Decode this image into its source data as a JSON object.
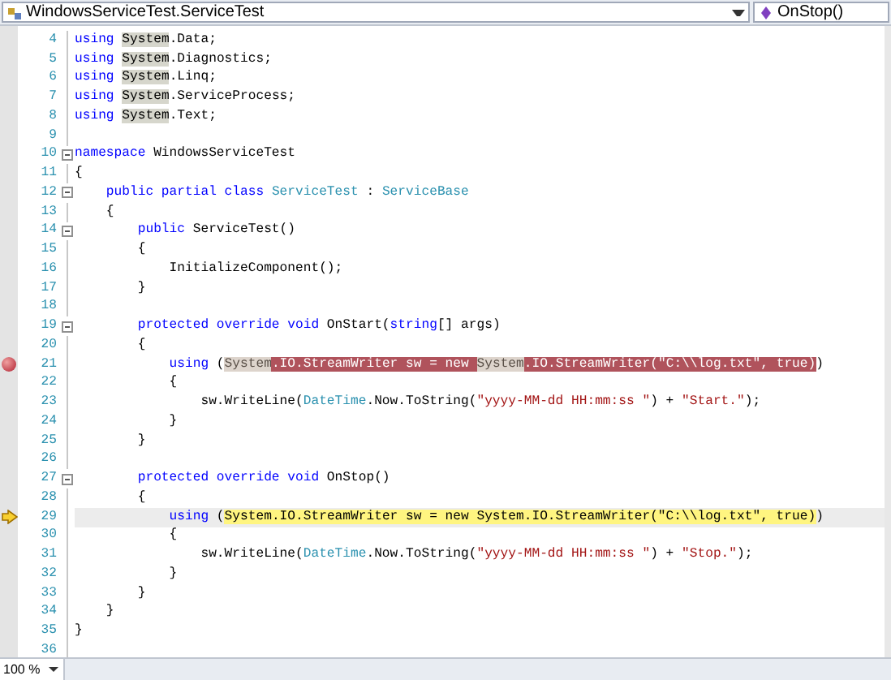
{
  "navigation_bar": {
    "type_dropdown": "WindowsServiceTest.ServiceTest",
    "member_dropdown": "OnStop()"
  },
  "editor": {
    "lines": [
      {
        "number": "4",
        "breakpoint": false,
        "current": false,
        "collapsible": false,
        "segments": [
          {
            "text": "using ",
            "kind": "keyword"
          },
          {
            "text": "System",
            "kind": "reference"
          },
          {
            "text": ".Data;",
            "kind": "plain"
          }
        ]
      },
      {
        "number": "5",
        "breakpoint": false,
        "current": false,
        "collapsible": false,
        "segments": [
          {
            "text": "using ",
            "kind": "keyword"
          },
          {
            "text": "System",
            "kind": "reference"
          },
          {
            "text": ".Diagnostics;",
            "kind": "plain"
          }
        ]
      },
      {
        "number": "6",
        "breakpoint": false,
        "current": false,
        "collapsible": false,
        "segments": [
          {
            "text": "using ",
            "kind": "keyword"
          },
          {
            "text": "System",
            "kind": "reference"
          },
          {
            "text": ".Linq;",
            "kind": "plain"
          }
        ]
      },
      {
        "number": "7",
        "breakpoint": false,
        "current": false,
        "collapsible": false,
        "segments": [
          {
            "text": "using ",
            "kind": "keyword"
          },
          {
            "text": "System",
            "kind": "reference"
          },
          {
            "text": ".ServiceProcess;",
            "kind": "plain"
          }
        ]
      },
      {
        "number": "8",
        "breakpoint": false,
        "current": false,
        "collapsible": false,
        "segments": [
          {
            "text": "using ",
            "kind": "keyword"
          },
          {
            "text": "System",
            "kind": "reference"
          },
          {
            "text": ".Text;",
            "kind": "plain"
          }
        ]
      },
      {
        "number": "9",
        "breakpoint": false,
        "current": false,
        "collapsible": false
      },
      {
        "number": "10",
        "breakpoint": false,
        "current": false,
        "collapsible": true,
        "segments": [
          {
            "text": "namespace",
            "kind": "keyword"
          },
          {
            "text": " WindowsServiceTest",
            "kind": "plain"
          }
        ]
      },
      {
        "number": "11",
        "breakpoint": false,
        "current": false,
        "collapsible": false,
        "segments": [
          {
            "text": "{",
            "kind": "plain"
          }
        ]
      },
      {
        "number": "12",
        "breakpoint": false,
        "current": false,
        "collapsible": true,
        "segments": [
          {
            "text": "    public partial class ",
            "kind": "keyword"
          },
          {
            "text": "ServiceTest",
            "kind": "type"
          },
          {
            "text": " : ",
            "kind": "plain"
          },
          {
            "text": "ServiceBase",
            "kind": "type"
          }
        ]
      },
      {
        "number": "13",
        "breakpoint": false,
        "current": false,
        "collapsible": false,
        "segments": [
          {
            "text": "    {",
            "kind": "plain"
          }
        ]
      },
      {
        "number": "14",
        "breakpoint": false,
        "current": false,
        "collapsible": true,
        "segments": [
          {
            "text": "        public",
            "kind": "keyword"
          },
          {
            "text": " ServiceTest()",
            "kind": "plain"
          }
        ]
      },
      {
        "number": "15",
        "breakpoint": false,
        "current": false,
        "collapsible": false,
        "segments": [
          {
            "text": "        {",
            "kind": "plain"
          }
        ]
      },
      {
        "number": "16",
        "breakpoint": false,
        "current": false,
        "collapsible": false,
        "segments": [
          {
            "text": "            InitializeComponent();",
            "kind": "plain"
          }
        ]
      },
      {
        "number": "17",
        "breakpoint": false,
        "current": false,
        "collapsible": false,
        "segments": [
          {
            "text": "        }",
            "kind": "plain"
          }
        ]
      },
      {
        "number": "18",
        "breakpoint": false,
        "current": false,
        "collapsible": false
      },
      {
        "number": "19",
        "breakpoint": false,
        "current": false,
        "collapsible": true,
        "segments": [
          {
            "text": "        protected override void",
            "kind": "keyword"
          },
          {
            "text": " OnStart(",
            "kind": "plain"
          },
          {
            "text": "string",
            "kind": "keyword"
          },
          {
            "text": "[] args)",
            "kind": "plain"
          }
        ]
      },
      {
        "number": "20",
        "breakpoint": false,
        "current": false,
        "collapsible": false,
        "segments": [
          {
            "text": "        {",
            "kind": "plain"
          }
        ]
      },
      {
        "number": "21",
        "breakpoint": true,
        "current": false,
        "collapsible": false,
        "segments": [
          {
            "text": "            using",
            "kind": "keyword"
          },
          {
            "text": " (",
            "kind": "plain"
          },
          {
            "text": "System",
            "kind": "reference",
            "highlighted": true
          },
          {
            "text": ".IO.StreamWriter sw = new ",
            "kind": "plain",
            "highlighted": true
          },
          {
            "text": "System",
            "kind": "reference",
            "highlighted": true
          },
          {
            "text": ".IO.StreamWriter(\"C:\\\\log.txt\", true)",
            "kind": "plain",
            "highlighted": true
          },
          {
            "text": ")",
            "kind": "plain"
          }
        ]
      },
      {
        "number": "22",
        "breakpoint": false,
        "current": false,
        "collapsible": false,
        "segments": [
          {
            "text": "            {",
            "kind": "plain"
          }
        ]
      },
      {
        "number": "23",
        "breakpoint": false,
        "current": false,
        "collapsible": false,
        "segments": [
          {
            "text": "                sw.WriteLine(",
            "kind": "plain"
          },
          {
            "text": "DateTime",
            "kind": "type"
          },
          {
            "text": ".Now.ToString(",
            "kind": "plain"
          },
          {
            "text": "\"yyyy-MM-dd HH:mm:ss \"",
            "kind": "string"
          },
          {
            "text": ") + ",
            "kind": "plain"
          },
          {
            "text": "\"Start.\"",
            "kind": "string"
          },
          {
            "text": ");",
            "kind": "plain"
          }
        ]
      },
      {
        "number": "24",
        "breakpoint": false,
        "current": false,
        "collapsible": false,
        "segments": [
          {
            "text": "            }",
            "kind": "plain"
          }
        ]
      },
      {
        "number": "25",
        "breakpoint": false,
        "current": false,
        "collapsible": false,
        "segments": [
          {
            "text": "        }",
            "kind": "plain"
          }
        ]
      },
      {
        "number": "26",
        "breakpoint": false,
        "current": false,
        "collapsible": false
      },
      {
        "number": "27",
        "breakpoint": false,
        "current": false,
        "collapsible": true,
        "segments": [
          {
            "text": "        protected override void",
            "kind": "keyword"
          },
          {
            "text": " OnStop()",
            "kind": "plain"
          }
        ]
      },
      {
        "number": "28",
        "breakpoint": false,
        "current": false,
        "collapsible": false,
        "segments": [
          {
            "text": "        {",
            "kind": "plain"
          }
        ]
      },
      {
        "number": "29",
        "breakpoint": false,
        "current": true,
        "collapsible": false,
        "segments": [
          {
            "text": "            using",
            "kind": "keyword"
          },
          {
            "text": " (",
            "kind": "plain"
          },
          {
            "text": "System.IO.StreamWriter sw = new System.IO.StreamWriter(\"C:\\\\log.txt\", true)",
            "kind": "plain",
            "highlighted": true
          },
          {
            "text": ")",
            "kind": "plain"
          }
        ]
      },
      {
        "number": "30",
        "breakpoint": false,
        "current": false,
        "collapsible": false,
        "segments": [
          {
            "text": "            {",
            "kind": "plain"
          }
        ]
      },
      {
        "number": "31",
        "breakpoint": false,
        "current": false,
        "collapsible": false,
        "segments": [
          {
            "text": "                sw.WriteLine(",
            "kind": "plain"
          },
          {
            "text": "DateTime",
            "kind": "type"
          },
          {
            "text": ".Now.ToString(",
            "kind": "plain"
          },
          {
            "text": "\"yyyy-MM-dd HH:mm:ss \"",
            "kind": "string"
          },
          {
            "text": ") + ",
            "kind": "plain"
          },
          {
            "text": "\"Stop.\"",
            "kind": "string"
          },
          {
            "text": ");",
            "kind": "plain"
          }
        ]
      },
      {
        "number": "32",
        "breakpoint": false,
        "current": false,
        "collapsible": false,
        "segments": [
          {
            "text": "            }",
            "kind": "plain"
          }
        ]
      },
      {
        "number": "33",
        "breakpoint": false,
        "current": false,
        "collapsible": false,
        "segments": [
          {
            "text": "        }",
            "kind": "plain"
          }
        ]
      },
      {
        "number": "34",
        "breakpoint": false,
        "current": false,
        "collapsible": false,
        "segments": [
          {
            "text": "    }",
            "kind": "plain"
          }
        ]
      },
      {
        "number": "35",
        "breakpoint": false,
        "current": false,
        "collapsible": false,
        "segments": [
          {
            "text": "}",
            "kind": "plain"
          }
        ]
      },
      {
        "number": "36",
        "breakpoint": false,
        "current": false,
        "collapsible": false
      }
    ]
  },
  "status_bar": {
    "zoom": "100 %"
  }
}
